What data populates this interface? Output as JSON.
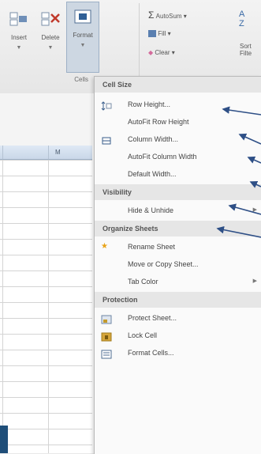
{
  "ribbon": {
    "insert_label": "Insert",
    "delete_label": "Delete",
    "format_label": "Format",
    "group_cells_label": "Cells",
    "autosum_label": "AutoSum",
    "fill_label": "Fill",
    "clear_label": "Clear",
    "sort_label": "Sort",
    "filter_label": "Filte"
  },
  "sheet": {
    "column_label": "M"
  },
  "menu": {
    "cell_size_header": "Cell Size",
    "row_height": "Row Height...",
    "autofit_row_height": "AutoFit Row Height",
    "column_width": "Column Width...",
    "autofit_column_width": "AutoFit Column Width",
    "default_width": "Default Width...",
    "visibility_header": "Visibility",
    "hide_unhide": "Hide & Unhide",
    "organize_header": "Organize Sheets",
    "rename_sheet": "Rename Sheet",
    "move_copy_sheet": "Move or Copy Sheet...",
    "tab_color": "Tab Color",
    "protection_header": "Protection",
    "protect_sheet": "Protect Sheet...",
    "lock_cell": "Lock Cell",
    "format_cells": "Format Cells..."
  },
  "colors": {
    "accent": "#1f4e79",
    "menu_bg": "#fafafa",
    "header_bg": "#e6e6e6"
  }
}
